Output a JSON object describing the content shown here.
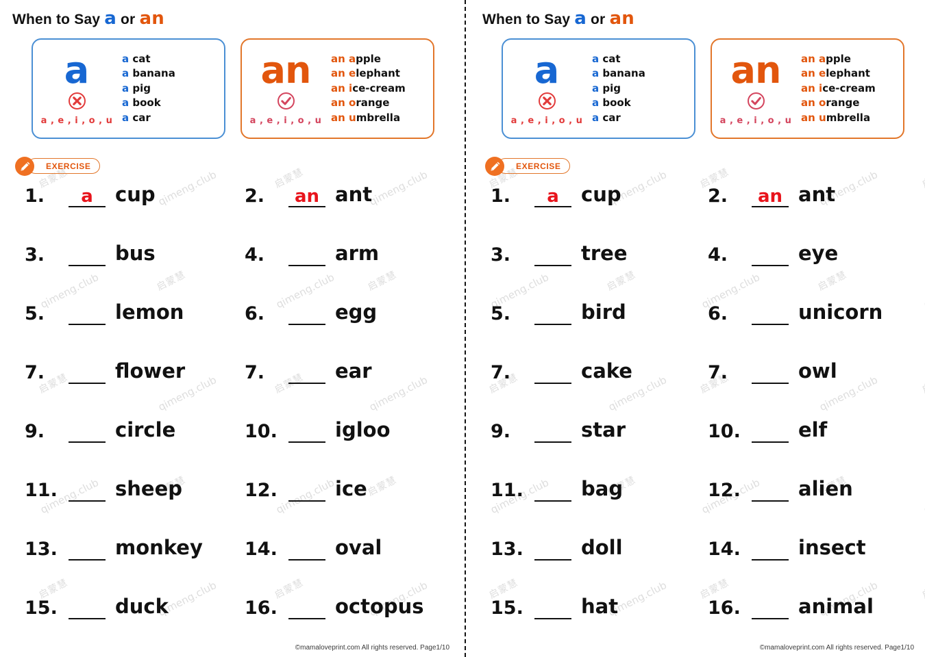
{
  "title": {
    "prefix": "When to Say ",
    "article_a": "a",
    "conjunction": " or ",
    "article_an": "an"
  },
  "info_boxes": {
    "a_box": {
      "big_letter": "a",
      "mark_icon": "circled-x-icon",
      "vowels_label": "a , e , i , o , u",
      "examples": [
        {
          "article": "a",
          "first": "c",
          "rest": "at"
        },
        {
          "article": "a",
          "first": "b",
          "rest": "anana"
        },
        {
          "article": "a",
          "first": "p",
          "rest": "ig"
        },
        {
          "article": "a",
          "first": "b",
          "rest": "ook"
        },
        {
          "article": "a",
          "first": "c",
          "rest": "ar"
        }
      ]
    },
    "an_box": {
      "big_letter": "an",
      "mark_icon": "circled-check-icon",
      "vowels_label": "a , e , i , o , u",
      "examples": [
        {
          "article": "an",
          "first": "a",
          "rest": "pple"
        },
        {
          "article": "an",
          "first": "e",
          "rest": "lephant"
        },
        {
          "article": "an",
          "first": "i",
          "rest": "ce-cream"
        },
        {
          "article": "an",
          "first": "o",
          "rest": "range"
        },
        {
          "article": "an",
          "first": "u",
          "rest": "mbrella"
        }
      ]
    }
  },
  "exercise_badge": {
    "label": "EXERCISE",
    "icon": "pencil-icon"
  },
  "left_page": {
    "items": [
      {
        "number": "1.",
        "answer": "a",
        "word": "cup"
      },
      {
        "number": "2.",
        "answer": "an",
        "word": "ant"
      },
      {
        "number": "3.",
        "answer": "",
        "word": "bus"
      },
      {
        "number": "4.",
        "answer": "",
        "word": "arm"
      },
      {
        "number": "5.",
        "answer": "",
        "word": "lemon"
      },
      {
        "number": "6.",
        "answer": "",
        "word": "egg"
      },
      {
        "number": "7.",
        "answer": "",
        "word": "flower"
      },
      {
        "number": "7.",
        "answer": "",
        "word": "ear"
      },
      {
        "number": "9.",
        "answer": "",
        "word": "circle"
      },
      {
        "number": "10.",
        "answer": "",
        "word": "igloo"
      },
      {
        "number": "11.",
        "answer": "",
        "word": "sheep"
      },
      {
        "number": "12.",
        "answer": "",
        "word": "ice"
      },
      {
        "number": "13.",
        "answer": "",
        "word": "monkey"
      },
      {
        "number": "14.",
        "answer": "",
        "word": "oval"
      },
      {
        "number": "15.",
        "answer": "",
        "word": "duck"
      },
      {
        "number": "16.",
        "answer": "",
        "word": "octopus"
      }
    ],
    "footer": "©mamaloveprint.com All rights reserved. Page1/10"
  },
  "right_page": {
    "items": [
      {
        "number": "1.",
        "answer": "a",
        "word": "cup"
      },
      {
        "number": "2.",
        "answer": "an",
        "word": "ant"
      },
      {
        "number": "3.",
        "answer": "",
        "word": "tree"
      },
      {
        "number": "4.",
        "answer": "",
        "word": "eye"
      },
      {
        "number": "5.",
        "answer": "",
        "word": "bird"
      },
      {
        "number": "6.",
        "answer": "",
        "word": "unicorn"
      },
      {
        "number": "7.",
        "answer": "",
        "word": "cake"
      },
      {
        "number": "7.",
        "answer": "",
        "word": "owl"
      },
      {
        "number": "9.",
        "answer": "",
        "word": "star"
      },
      {
        "number": "10.",
        "answer": "",
        "word": "elf"
      },
      {
        "number": "11.",
        "answer": "",
        "word": "bag"
      },
      {
        "number": "12.",
        "answer": "",
        "word": "alien"
      },
      {
        "number": "13.",
        "answer": "",
        "word": "doll"
      },
      {
        "number": "14.",
        "answer": "",
        "word": "insect"
      },
      {
        "number": "15.",
        "answer": "",
        "word": "hat"
      },
      {
        "number": "16.",
        "answer": "",
        "word": "animal"
      }
    ],
    "footer": "©mamaloveprint.com All rights reserved. Page1/10"
  },
  "watermarks": {
    "cn_text": "启蒙慧",
    "en_text": "qimeng.club"
  },
  "colors": {
    "blue": "#1767d2",
    "orange": "#e2560d",
    "red_answer": "#e8141c",
    "vowel_red": "#e23b3b",
    "box_blue_border": "#4a8fd4",
    "box_orange_border": "#e2762a"
  }
}
